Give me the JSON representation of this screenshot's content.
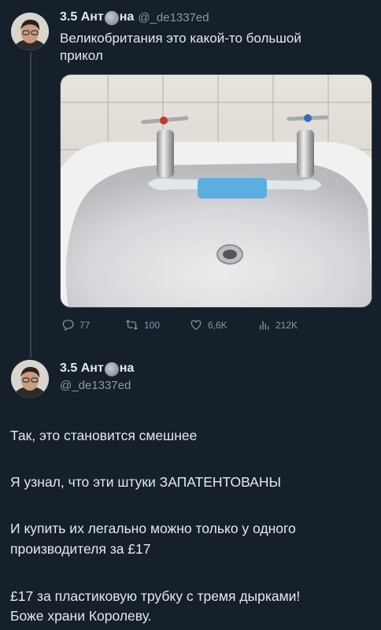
{
  "tweet1": {
    "display_name_pre": "3.5 Ант",
    "display_name_post": "на",
    "handle": "@_de1337ed",
    "text_line1": "Великобритания это какой-то большой",
    "text_line2": "прикол",
    "actions": {
      "replies": "77",
      "retweets": "100",
      "likes": "6,6K",
      "views": "212K"
    },
    "icons": [
      "reply-icon",
      "retweet-icon",
      "like-icon",
      "views-icon"
    ]
  },
  "tweet2": {
    "display_name_pre": "3.5 Ант",
    "display_name_post": "на",
    "handle": "@_de1337ed",
    "paragraphs": [
      "Так, это становится смешнее",
      "Я узнал, что эти штуки ЗАПАТЕНТОВАНЫ",
      "И купить их легально можно только у одного",
      "производителя за £17",
      "£17 за пластиковую трубку с тремя дырками!",
      "Боже храни Королеву."
    ]
  },
  "colors": {
    "background": "#15202b",
    "text": "#e7e9ea",
    "secondary": "#8b98a5",
    "line": "#38444d"
  }
}
